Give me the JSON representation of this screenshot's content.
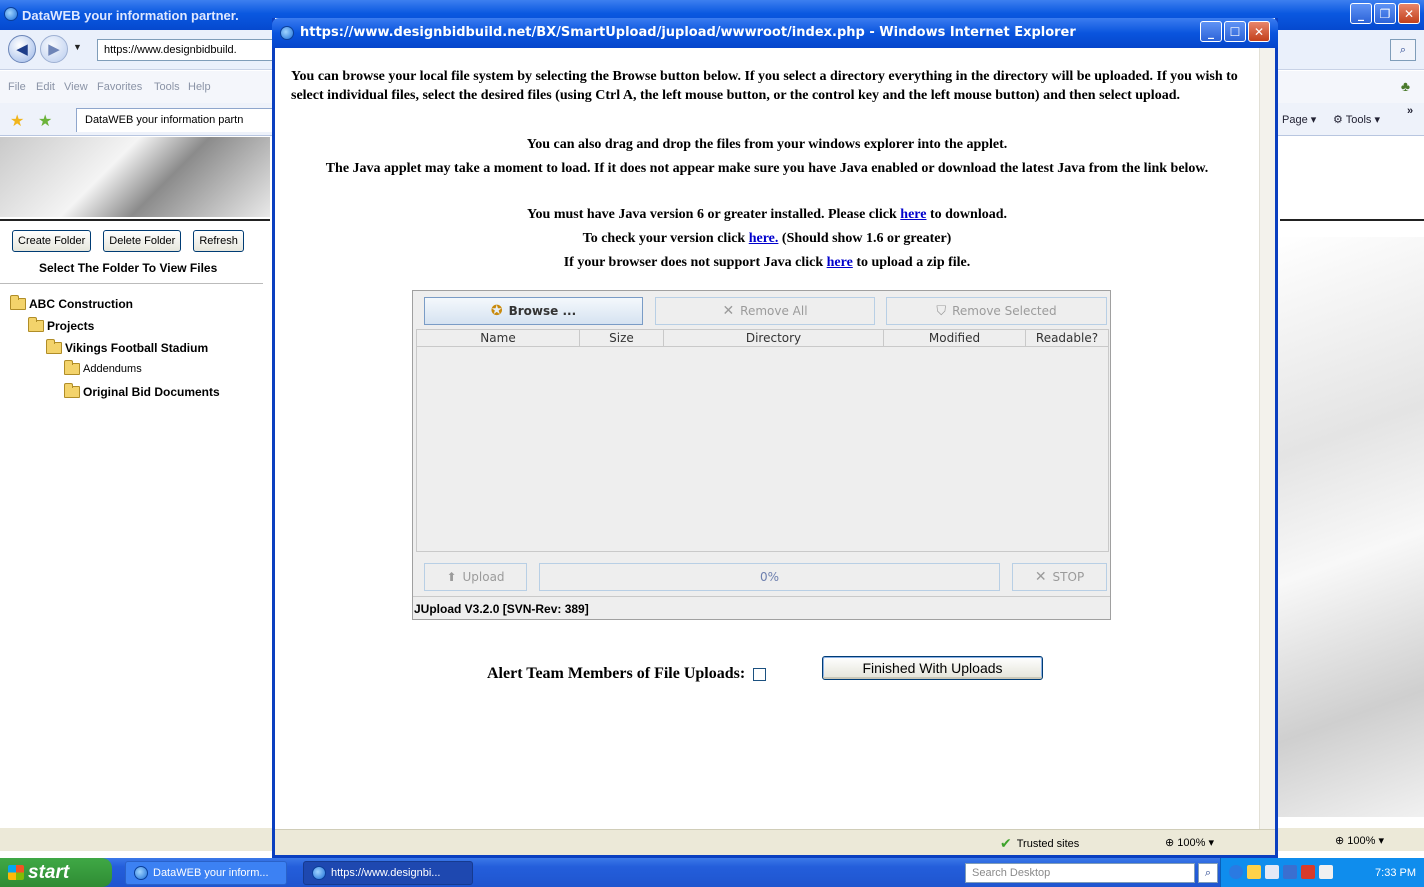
{
  "main_window": {
    "title": "DataWEB your information partner.",
    "address": "https://www.designbidbuild.",
    "menu": [
      "File",
      "Edit",
      "View",
      "Favorites",
      "Tools",
      "Help"
    ],
    "fav_tab": "DataWEB your information partn",
    "page_menu": "Page",
    "tools_menu": "Tools",
    "chevron": "»",
    "zoom": "100%"
  },
  "sidebar": {
    "buttons": {
      "create_folder": "Create Folder",
      "delete_folder": "Delete Folder",
      "refresh": "Refresh"
    },
    "title": "Select The Folder To View Files",
    "tree": [
      {
        "label": "ABC Construction",
        "level": 0,
        "open": true
      },
      {
        "label": "Projects",
        "level": 1,
        "open": true
      },
      {
        "label": "Vikings Football Stadium",
        "level": 2,
        "open": true
      },
      {
        "label": "Addendums",
        "level": 3,
        "open": false
      },
      {
        "label": "Original Bid Documents",
        "level": 3,
        "open": true
      }
    ]
  },
  "popup": {
    "title": "https://www.designbidbuild.net/BX/SmartUpload/jupload/wwwroot/index.php - Windows Internet Explorer",
    "intro": "You can browse your local file system by selecting the Browse button below. If you select a directory everything in the directory will be uploaded. If you wish to select individual files, select the desired files (using Ctrl A, the left mouse button, or the control key and the left mouse button) and then select upload.",
    "drag_drop": "You can also drag and drop the files from your windows explorer into the applet.",
    "java_notice": "The Java applet may take a moment to load. If it does not appear make sure you have Java enabled or download the latest Java from the link below.",
    "java_version_pre": "You must have Java version 6 or greater installed. Please click",
    "java_version_link": "here",
    "java_version_post": "to download.",
    "check_pre": "To check your version click",
    "check_link": "here.",
    "check_post": "(Should show 1.6 or greater)",
    "zip_pre": "If your browser does not support Java click",
    "zip_link": "here",
    "zip_post": "to upload a zip file.",
    "applet": {
      "browse": "Browse ...",
      "remove_all": "Remove All",
      "remove_selected": "Remove Selected",
      "columns": [
        "Name",
        "Size",
        "Directory",
        "Modified",
        "Readable?"
      ],
      "upload": "Upload",
      "progress_label": "0%",
      "progress": 0,
      "stop": "STOP",
      "version": "JUpload V3.2.0 [SVN-Rev: 389]"
    },
    "alert_label": "Alert Team Members of File Uploads:",
    "alert_checked": false,
    "finished_button": "Finished With Uploads",
    "status_trusted": "Trusted sites",
    "status_zoom": "100%"
  },
  "taskbar": {
    "start": "start",
    "items": [
      "DataWEB your inform...",
      "https://www.designbi..."
    ],
    "search_placeholder": "Search Desktop",
    "clock": "7:33 PM"
  }
}
